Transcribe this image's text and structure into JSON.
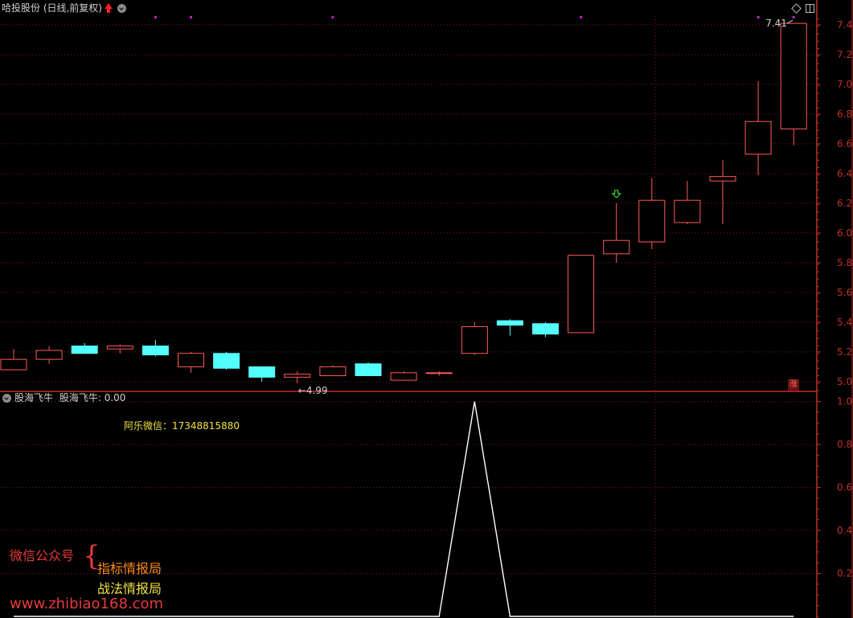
{
  "header": {
    "title": "哈投股份 (日线,前复权)",
    "subchart_name": "股海飞牛",
    "subchart_value": "股海飞牛: 0.00"
  },
  "watermark": {
    "contact": "阿乐微信：17348815880",
    "wechat_label": "微信公众号",
    "brace": "{",
    "line1": "指标情报局",
    "line2": "战法情报局",
    "url": "www.zhibiao168.com"
  },
  "badge": {
    "zhang": "涨"
  },
  "colors": {
    "up": "#ff5a5a",
    "down": "#54ffff",
    "axis": "#c0302a",
    "grid": "#7a1e1e",
    "signal": "#ffffff",
    "marker": "#c020c0",
    "arrow_down": "#40ff40"
  },
  "chart_data": [
    {
      "type": "candlestick",
      "title": "哈投股份 (日线,前复权)",
      "ylim": [
        4.94,
        7.47
      ],
      "yticks": [
        "5.00",
        "5.20",
        "5.40",
        "5.60",
        "5.80",
        "6.00",
        "6.20",
        "6.40",
        "6.60",
        "6.80",
        "7.00",
        "7.20",
        "7.40"
      ],
      "candles": [
        {
          "o": 5.08,
          "c": 5.15,
          "h": 5.22,
          "l": 5.08
        },
        {
          "o": 5.15,
          "c": 5.21,
          "h": 5.24,
          "l": 5.12
        },
        {
          "o": 5.24,
          "c": 5.19,
          "h": 5.26,
          "l": 5.19
        },
        {
          "o": 5.22,
          "c": 5.24,
          "h": 5.25,
          "l": 5.19
        },
        {
          "o": 5.24,
          "c": 5.18,
          "h": 5.28,
          "l": 5.17
        },
        {
          "o": 5.1,
          "c": 5.19,
          "h": 5.2,
          "l": 5.06
        },
        {
          "o": 5.19,
          "c": 5.09,
          "h": 5.2,
          "l": 5.08
        },
        {
          "o": 5.1,
          "c": 5.03,
          "h": 5.1,
          "l": 5.0
        },
        {
          "o": 5.03,
          "c": 5.05,
          "h": 5.07,
          "l": 4.99
        },
        {
          "o": 5.04,
          "c": 5.1,
          "h": 5.11,
          "l": 5.04
        },
        {
          "o": 5.12,
          "c": 5.04,
          "h": 5.13,
          "l": 5.04
        },
        {
          "o": 5.01,
          "c": 5.06,
          "h": 5.07,
          "l": 5.01
        },
        {
          "o": 5.06,
          "c": 5.06,
          "h": 5.07,
          "l": 5.04
        },
        {
          "o": 5.19,
          "c": 5.37,
          "h": 5.4,
          "l": 5.18
        },
        {
          "o": 5.41,
          "c": 5.38,
          "h": 5.42,
          "l": 5.31
        },
        {
          "o": 5.39,
          "c": 5.32,
          "h": 5.4,
          "l": 5.3
        },
        {
          "o": 5.33,
          "c": 5.85,
          "h": 5.85,
          "l": 5.33
        },
        {
          "o": 5.86,
          "c": 5.95,
          "h": 6.2,
          "l": 5.8
        },
        {
          "o": 5.94,
          "c": 6.22,
          "h": 6.37,
          "l": 5.89
        },
        {
          "o": 6.07,
          "c": 6.22,
          "h": 6.35,
          "l": 6.06
        },
        {
          "o": 6.35,
          "c": 6.38,
          "h": 6.49,
          "l": 6.06
        },
        {
          "o": 6.53,
          "c": 6.75,
          "h": 7.02,
          "l": 6.39
        },
        {
          "o": 6.7,
          "c": 7.41,
          "h": 7.41,
          "l": 6.59
        }
      ],
      "annotations": [
        {
          "label": "←4.99",
          "index": 8,
          "value": 4.99
        },
        {
          "label": "7.41",
          "index": 22,
          "value": 7.41
        }
      ],
      "signals_down_arrow": [
        17
      ],
      "top_markers": [
        4,
        5,
        9,
        16,
        21,
        22
      ]
    },
    {
      "type": "line",
      "title": "股海飞牛",
      "ylim": [
        0,
        1.04
      ],
      "yticks": [
        "0.20",
        "0.40",
        "0.60",
        "0.80",
        "1.00"
      ],
      "series": [
        {
          "name": "股海飞牛",
          "values": [
            0,
            0,
            0,
            0,
            0,
            0,
            0,
            0,
            0,
            0,
            0,
            0,
            0,
            1,
            0,
            0,
            0,
            0,
            0,
            0,
            0,
            0,
            0
          ]
        }
      ]
    }
  ]
}
